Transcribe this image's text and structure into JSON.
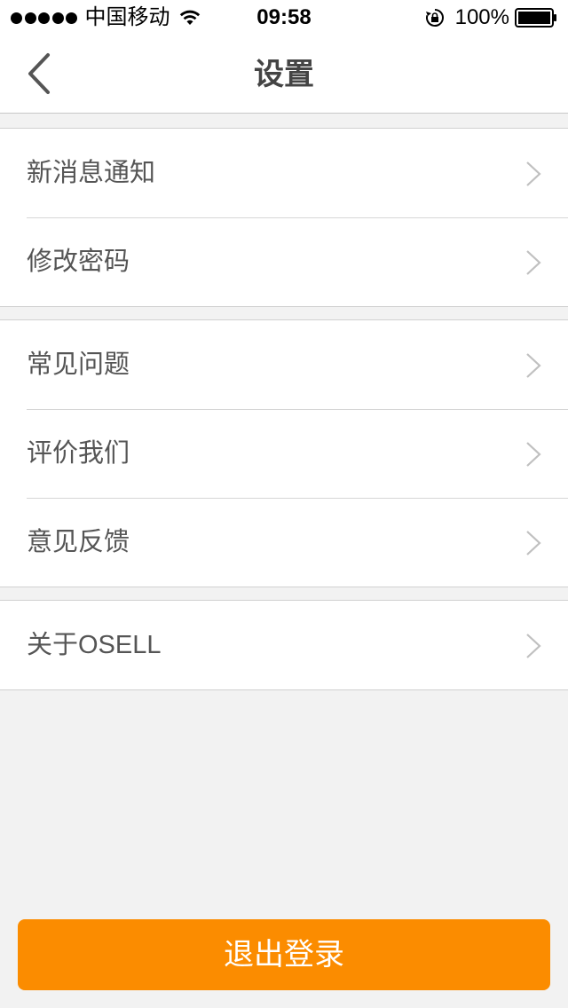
{
  "status_bar": {
    "carrier": "中国移动",
    "time": "09:58",
    "battery": "100%"
  },
  "nav": {
    "title": "设置"
  },
  "groups": [
    {
      "items": [
        {
          "label": "新消息通知"
        },
        {
          "label": "修改密码"
        }
      ]
    },
    {
      "items": [
        {
          "label": "常见问题"
        },
        {
          "label": "评价我们"
        },
        {
          "label": "意见反馈"
        }
      ]
    },
    {
      "items": [
        {
          "label": "关于OSELL"
        }
      ]
    }
  ],
  "logout": {
    "label": "退出登录"
  },
  "colors": {
    "accent": "#fb8c00",
    "background": "#f2f2f2"
  }
}
